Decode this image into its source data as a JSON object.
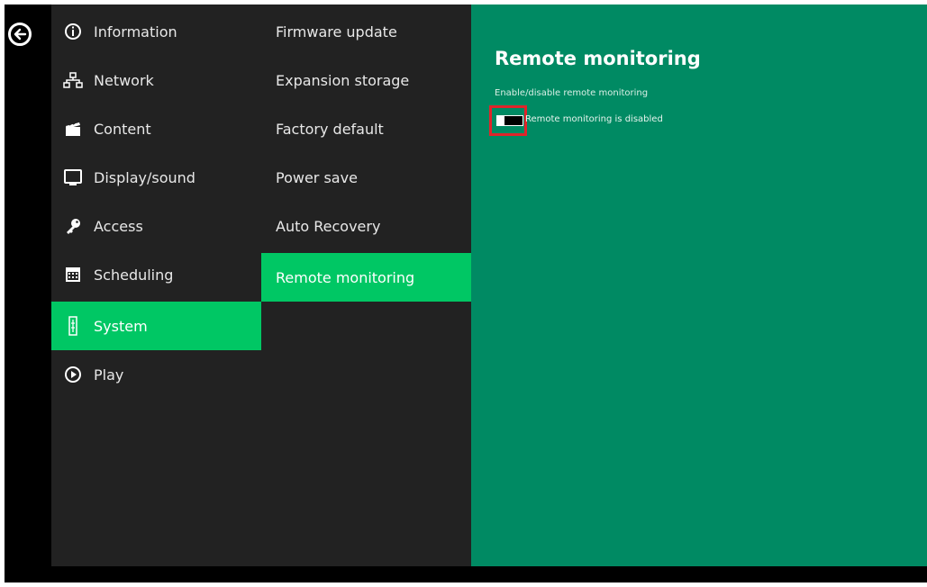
{
  "menu_primary": [
    {
      "label": "Information",
      "icon": "info-icon"
    },
    {
      "label": "Network",
      "icon": "network-icon"
    },
    {
      "label": "Content",
      "icon": "clapperboard-icon"
    },
    {
      "label": "Display/sound",
      "icon": "monitor-icon"
    },
    {
      "label": "Access",
      "icon": "key-icon"
    },
    {
      "label": "Scheduling",
      "icon": "calendar-icon"
    },
    {
      "label": "System",
      "icon": "system-icon",
      "active": true
    },
    {
      "label": "Play",
      "icon": "play-icon"
    }
  ],
  "menu_secondary": [
    {
      "label": "Firmware update"
    },
    {
      "label": "Expansion storage"
    },
    {
      "label": "Factory default"
    },
    {
      "label": "Power save"
    },
    {
      "label": "Auto Recovery"
    },
    {
      "label": "Remote monitoring",
      "active": true
    }
  ],
  "panel": {
    "title": "Remote monitoring",
    "subtitle": "Enable/disable remote monitoring",
    "toggle_label": "Remote monitoring is disabled",
    "toggle_on": false
  },
  "colors": {
    "accent": "#00c764",
    "panel_bg": "#008a63",
    "menu_bg": "#222222",
    "highlight_box": "#e0242a"
  }
}
